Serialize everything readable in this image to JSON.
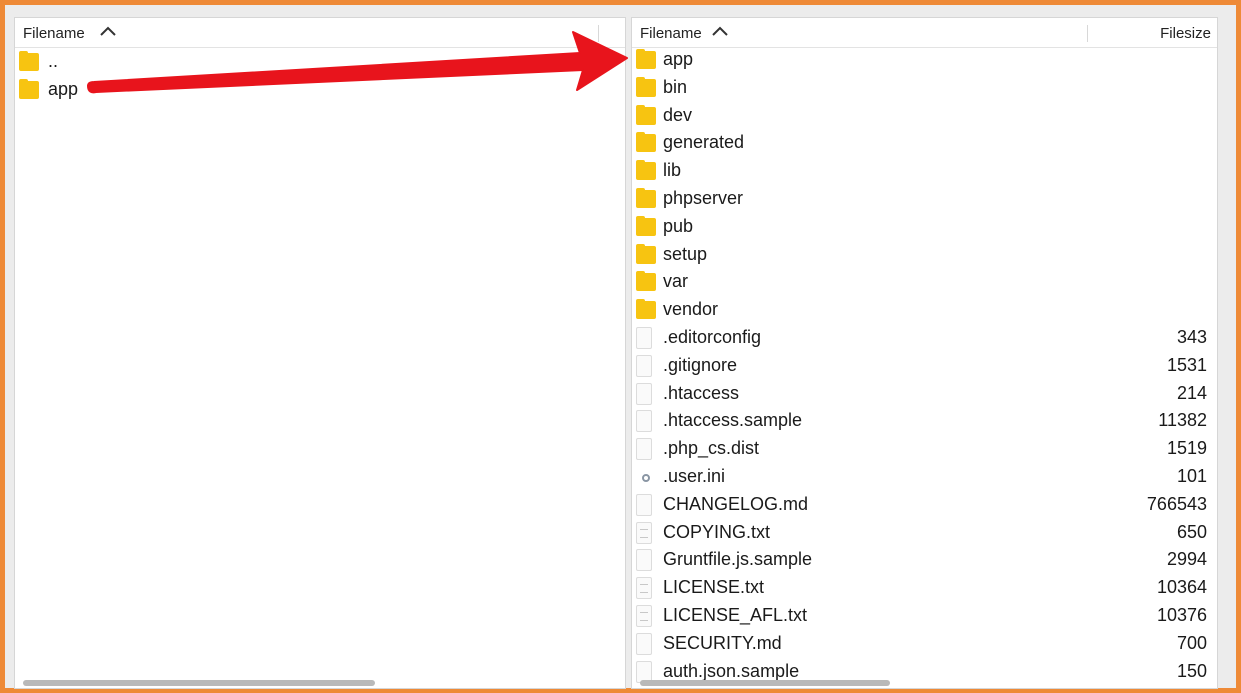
{
  "left_pane": {
    "header": {
      "filename_label": "Filename"
    },
    "items": [
      {
        "name": "..",
        "type": "folder"
      },
      {
        "name": "app",
        "type": "folder"
      }
    ]
  },
  "right_pane": {
    "header": {
      "filename_label": "Filename",
      "filesize_label": "Filesize"
    },
    "items": [
      {
        "name": "app",
        "type": "folder",
        "size": ""
      },
      {
        "name": "bin",
        "type": "folder",
        "size": ""
      },
      {
        "name": "dev",
        "type": "folder",
        "size": ""
      },
      {
        "name": "generated",
        "type": "folder",
        "size": ""
      },
      {
        "name": "lib",
        "type": "folder",
        "size": ""
      },
      {
        "name": "phpserver",
        "type": "folder",
        "size": ""
      },
      {
        "name": "pub",
        "type": "folder",
        "size": ""
      },
      {
        "name": "setup",
        "type": "folder",
        "size": ""
      },
      {
        "name": "var",
        "type": "folder",
        "size": ""
      },
      {
        "name": "vendor",
        "type": "folder",
        "size": ""
      },
      {
        "name": ".editorconfig",
        "type": "file",
        "size": "343"
      },
      {
        "name": ".gitignore",
        "type": "file",
        "size": "1531"
      },
      {
        "name": ".htaccess",
        "type": "file",
        "size": "214"
      },
      {
        "name": ".htaccess.sample",
        "type": "file",
        "size": "11382"
      },
      {
        "name": ".php_cs.dist",
        "type": "file",
        "size": "1519"
      },
      {
        "name": ".user.ini",
        "type": "settings",
        "size": "101"
      },
      {
        "name": "CHANGELOG.md",
        "type": "file",
        "size": "766543"
      },
      {
        "name": "COPYING.txt",
        "type": "text",
        "size": "650"
      },
      {
        "name": "Gruntfile.js.sample",
        "type": "file",
        "size": "2994"
      },
      {
        "name": "LICENSE.txt",
        "type": "text",
        "size": "10364"
      },
      {
        "name": "LICENSE_AFL.txt",
        "type": "text",
        "size": "10376"
      },
      {
        "name": "SECURITY.md",
        "type": "file",
        "size": "700"
      },
      {
        "name": "auth.json.sample",
        "type": "file",
        "size": "150"
      }
    ]
  },
  "colors": {
    "frame_border": "#ee8a37",
    "folder": "#f7c411",
    "arrow": "#e8141c"
  },
  "icons": {
    "sort": "chevron-up-icon",
    "folder": "folder-icon",
    "file": "file-icon",
    "text": "text-file-icon",
    "settings": "gear-icon",
    "annotation": "arrow-icon"
  }
}
